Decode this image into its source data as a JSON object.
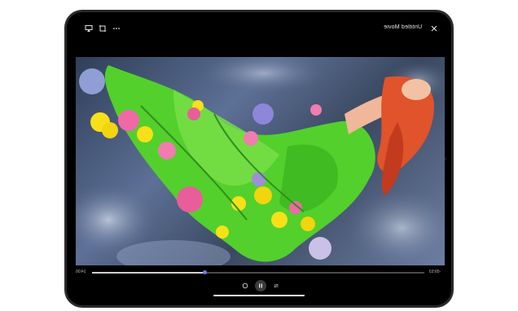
{
  "header": {
    "title": "Untitled Movie",
    "airplay_icon": "airplay-icon",
    "crop_icon": "crop-icon",
    "more_icon": "more-icon",
    "close_icon": "close-icon"
  },
  "player": {
    "time_elapsed": "14:06",
    "time_remaining": "-09:53",
    "progress_fraction": 0.34,
    "replay_icon": "rewind-icon",
    "pause_icon": "pause-icon",
    "loop_icon": "loop-icon"
  },
  "colors": {
    "bezel": "#2a2a2c",
    "accent": "#6f7bff"
  }
}
